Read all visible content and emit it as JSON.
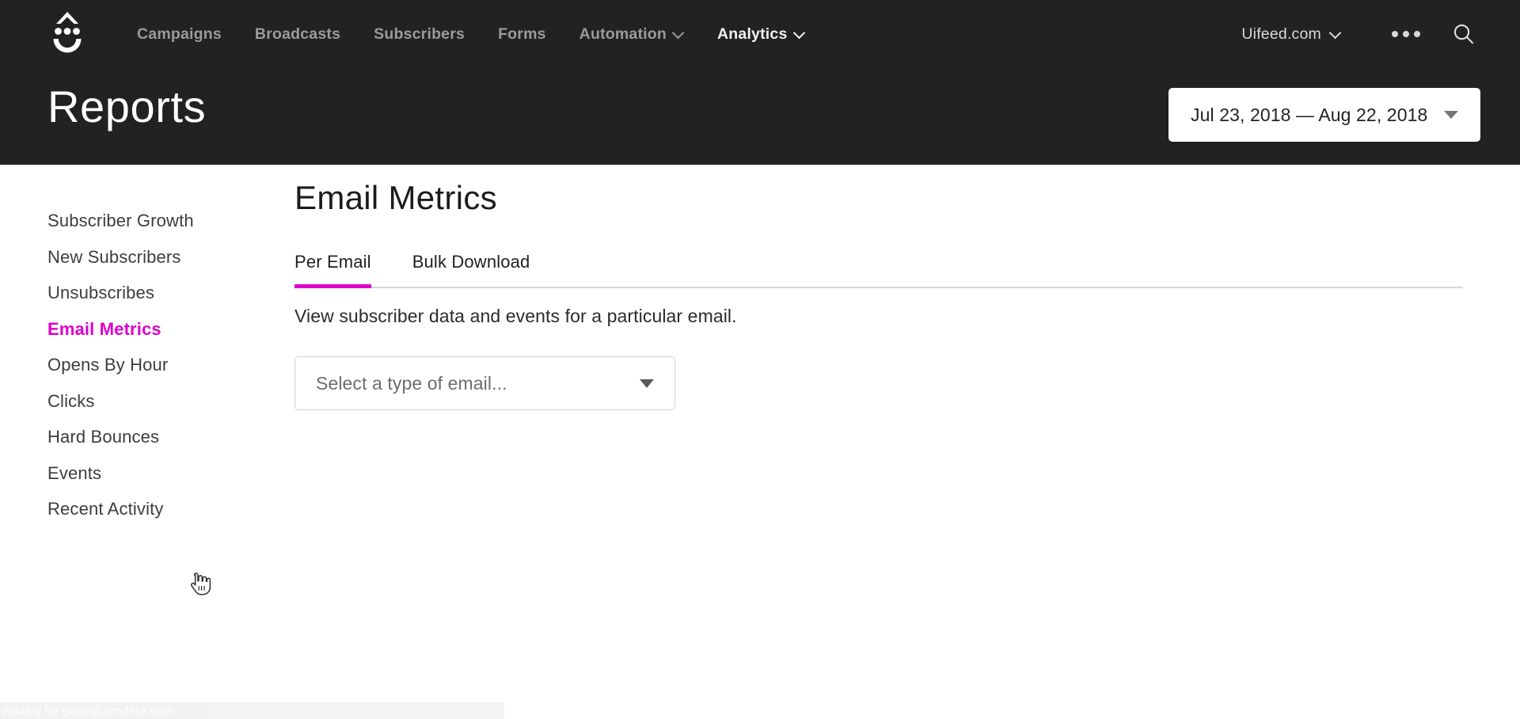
{
  "brand": {
    "logo_icon": "drip-smiley-logo",
    "accent_color": "#dd00cc",
    "header_bg": "#222222"
  },
  "topnav": {
    "items": [
      {
        "label": "Campaigns",
        "has_chevron": false,
        "active": false
      },
      {
        "label": "Broadcasts",
        "has_chevron": false,
        "active": false
      },
      {
        "label": "Subscribers",
        "has_chevron": false,
        "active": false
      },
      {
        "label": "Forms",
        "has_chevron": false,
        "active": false
      },
      {
        "label": "Automation",
        "has_chevron": true,
        "active": false
      },
      {
        "label": "Analytics",
        "has_chevron": true,
        "active": true
      }
    ],
    "account": {
      "label": "Uifeed.com",
      "chevron_icon": "chevron-down-icon"
    },
    "more_icon": "ellipsis-horizontal-icon",
    "search_icon": "search-icon"
  },
  "header": {
    "title": "Reports",
    "date_range": {
      "label": "Jul 23, 2018 — Aug 22, 2018",
      "caret_icon": "caret-down-icon"
    }
  },
  "sidebar": {
    "items": [
      {
        "label": "Subscriber Growth",
        "current": false
      },
      {
        "label": "New Subscribers",
        "current": false
      },
      {
        "label": "Unsubscribes",
        "current": false
      },
      {
        "label": "Email Metrics",
        "current": true
      },
      {
        "label": "Opens By Hour",
        "current": false
      },
      {
        "label": "Clicks",
        "current": false
      },
      {
        "label": "Hard Bounces",
        "current": false
      },
      {
        "label": "Events",
        "current": false
      },
      {
        "label": "Recent Activity",
        "current": false
      }
    ]
  },
  "main": {
    "title": "Email Metrics",
    "tabs": [
      {
        "label": "Per Email",
        "active": true
      },
      {
        "label": "Bulk Download",
        "active": false
      }
    ],
    "description": "View subscriber data and events for a particular email.",
    "email_select": {
      "placeholder": "Select a type of email...",
      "value": "",
      "caret_icon": "caret-down-icon"
    }
  },
  "status_bar": {
    "text": "Waiting for getdrip.zendesk.com…"
  }
}
